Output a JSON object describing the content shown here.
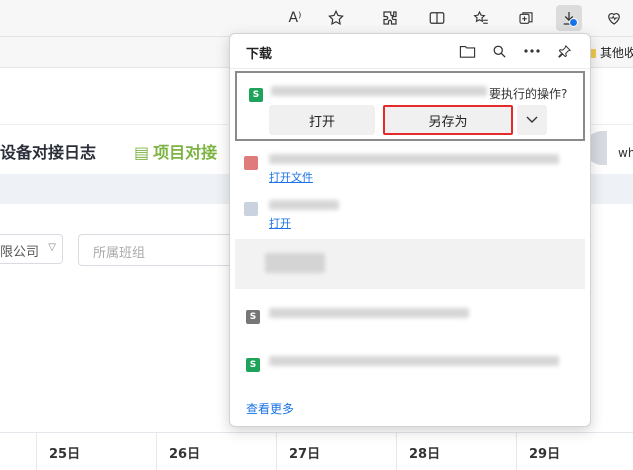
{
  "browser": {
    "read_aloud_glyph": "A⁾",
    "favorites_folder_label": "其他收"
  },
  "page": {
    "title_device_log": "设备对接日志",
    "title_project_log": "项目对接",
    "user_text": "wh",
    "company_select_value": "限公司",
    "team_input_placeholder": "所属班组",
    "date_columns": [
      "25日",
      "26日",
      "27日",
      "28日",
      "29日"
    ]
  },
  "downloads": {
    "title": "下载",
    "active_prompt_tail": "要执行的操作?",
    "open_button": "打开",
    "save_as_button": "另存为",
    "items": [
      {
        "open_link": "打开文件"
      },
      {
        "open_link": "打开"
      }
    ],
    "see_more": "查看更多"
  },
  "colors": {
    "save_as_highlight": "#e52a2a",
    "link_blue": "#1a73e8",
    "project_title_green": "#7cb342",
    "sheet_icon_green": "#1ea35a"
  }
}
